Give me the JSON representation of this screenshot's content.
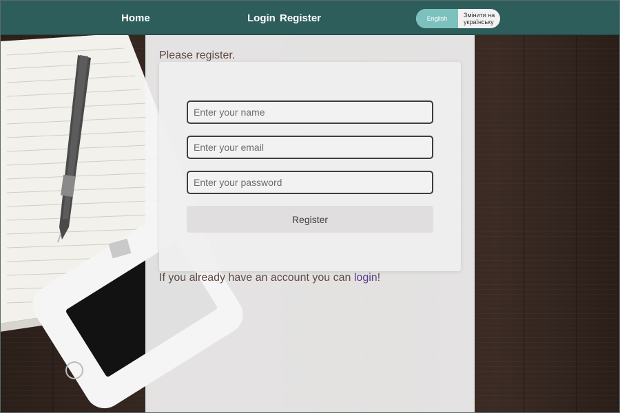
{
  "nav": {
    "home": "Home",
    "login": "Login",
    "register": "Register"
  },
  "language": {
    "current": "English",
    "switch": "Змінити на українську"
  },
  "page": {
    "title": "Please register."
  },
  "form": {
    "name_placeholder": "Enter your name",
    "email_placeholder": "Enter your email",
    "password_placeholder": "Enter your password",
    "submit_label": "Register"
  },
  "footer": {
    "text": "If you already have an account you can ",
    "link": "login",
    "suffix": "!"
  },
  "colors": {
    "nav_bg": "#2e5e5c",
    "lang_active": "#7cc1bd",
    "link": "#5a3b8c",
    "text": "#5d4a42"
  }
}
